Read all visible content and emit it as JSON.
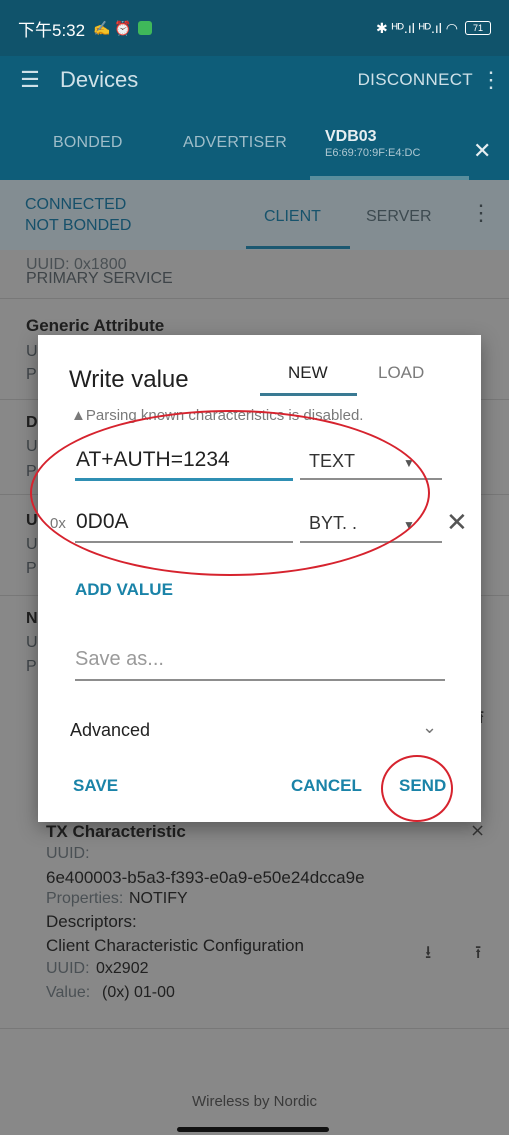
{
  "status_bar": {
    "time": "下午5:32",
    "left_icons": "✍ ⏰",
    "right_icons": "✱ ᴴᴰ.ıl ᴴᴰ.ıl ◠",
    "battery": "71"
  },
  "app_bar": {
    "menu_icon": "hamburger-icon",
    "title": "Devices",
    "disconnect_label": "DISCONNECT",
    "overflow_icon": "more-vert-icon"
  },
  "tabs": {
    "bonded": "BONDED",
    "advertiser": "ADVERTISER",
    "device_name": "VDB03",
    "device_mac": "E6:69:70:9F:E4:DC",
    "close": "✕"
  },
  "connection": {
    "status": "CONNECTED",
    "bond": "NOT BONDED",
    "client_tab": "CLIENT",
    "server_tab": "SERVER"
  },
  "services": {
    "row0_uuid": "UUID: 0x1800",
    "row0_type": "PRIMARY SERVICE",
    "generic_attribute": "Generic Attribute",
    "partial_letters": [
      "U",
      "P",
      "D",
      "U",
      "P",
      "U",
      "U",
      "P",
      "N",
      "U",
      "P"
    ]
  },
  "tx_characteristic": {
    "name": "TX Characteristic",
    "uuid_label": "UUID:",
    "uuid": "6e400003-b5a3-f393-e0a9-e50e24dcca9e",
    "properties_label": "Properties:",
    "properties": "NOTIFY",
    "descriptors_label": "Descriptors:",
    "descriptor_name": "Client Characteristic Configuration",
    "descriptor_uuid_label": "UUID:",
    "descriptor_uuid": "0x2902",
    "value_label": "Value:",
    "value": "(0x) 01-00"
  },
  "dialog": {
    "title": "Write value",
    "tab_new": "NEW",
    "tab_load": "LOAD",
    "warning": "▲Parsing known characteristics is disabled.",
    "field1_value": "AT+AUTH=1234",
    "field1_format": "TEXT",
    "field2_prefix": "0x",
    "field2_value": "0D0A",
    "field2_format": "BYT. .",
    "remove_icon": "✕",
    "add_value": "ADD VALUE",
    "save_as_placeholder": "Save as...",
    "advanced": "Advanced",
    "save": "SAVE",
    "cancel": "CANCEL",
    "send": "SEND"
  },
  "footer": "Wireless by Nordic"
}
